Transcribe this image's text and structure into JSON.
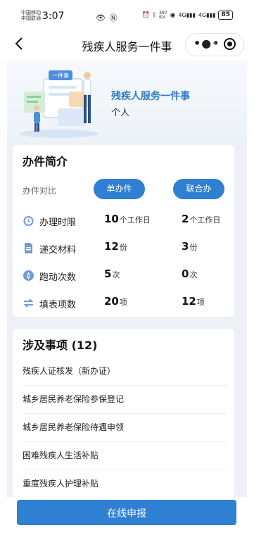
{
  "status_bar": {
    "carrier_1": "中国移动",
    "carrier_2": "中国联通",
    "time": "3:07",
    "net_speed": "397\nK/s",
    "battery": "85"
  },
  "nav": {
    "title": "残疾人服务一件事"
  },
  "hero": {
    "title": "残疾人服务一件事",
    "subtitle": "个人",
    "illustration_text": "一件事"
  },
  "summary": {
    "title": "办件简介",
    "compare_label": "办件对比",
    "tab_single": "单办件",
    "tab_joint": "联合办",
    "rows": [
      {
        "icon": "clock-icon",
        "label": "办理时限",
        "v1": "10",
        "u1": "个工作日",
        "v2": "2",
        "u2": "个工作日"
      },
      {
        "icon": "document-icon",
        "label": "递交材料",
        "v1": "12",
        "u1": "份",
        "v2": "3",
        "u2": "份"
      },
      {
        "icon": "compass-icon",
        "label": "跑动次数",
        "v1": "5",
        "u1": "次",
        "v2": "0",
        "u2": "次"
      },
      {
        "icon": "swap-icon",
        "label": "填表项数",
        "v1": "20",
        "u1": "项",
        "v2": "12",
        "u2": "项"
      }
    ]
  },
  "matters": {
    "title": "涉及事项 (12)",
    "items": [
      "残疾人证核发（新办证）",
      "城乡居民养老保险参保登记",
      "城乡居民养老保险待遇申领",
      "困难残疾人生活补贴",
      "重度残疾人护理补贴"
    ]
  },
  "bottom": {
    "apply_label": "在线申报"
  },
  "colors": {
    "accent": "#2f7fd2",
    "title_blue": "#2f7cc7",
    "icon_blue": "#6f9bd6"
  }
}
